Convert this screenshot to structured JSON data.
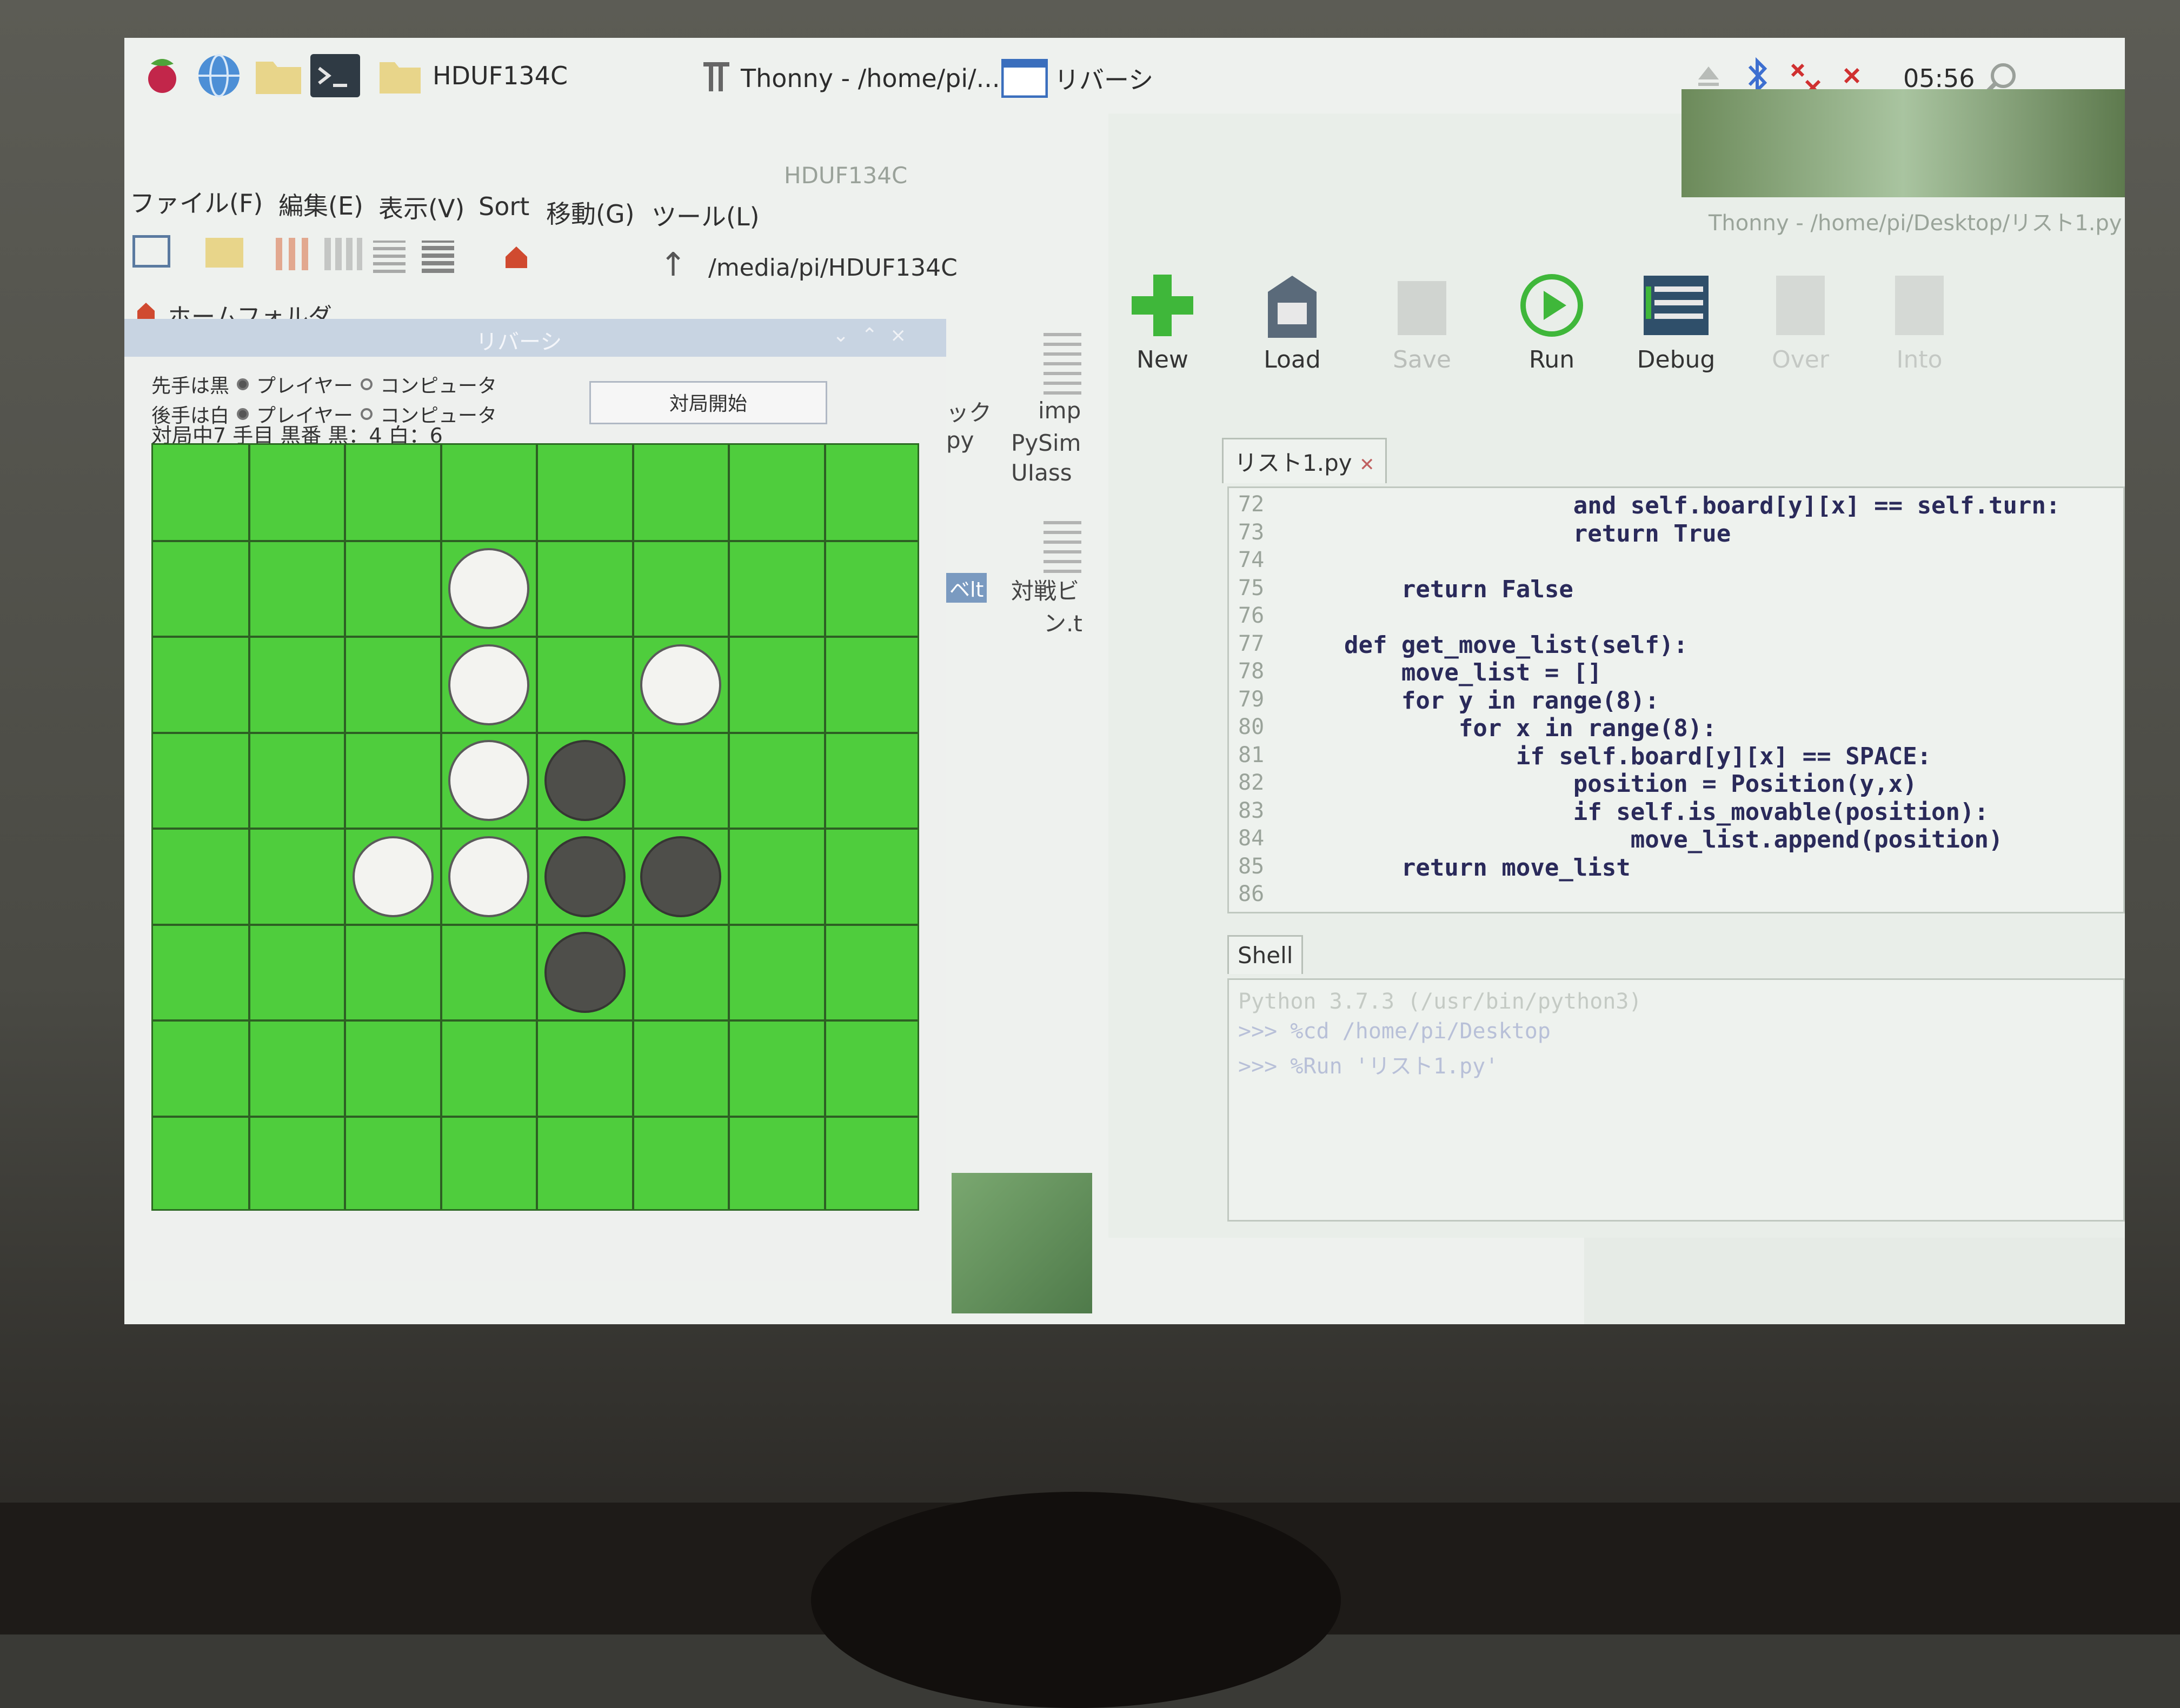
{
  "taskbar": {
    "folder_label": "HDUF134C",
    "thonny_label": "Thonny - /home/pi/...",
    "reversi_label": "リバーシ",
    "clock": "05:56"
  },
  "file_manager": {
    "title": "HDUF134C",
    "menu": [
      "ファイル(F)",
      "編集(E)",
      "表示(V)",
      "Sort",
      "移動(G)",
      "ツール(L)"
    ],
    "path": "/media/pi/HDUF134C",
    "home_folder": "ホームフォルダ",
    "files": [
      "ック",
      "py",
      "imp",
      "PySim",
      "UIass",
      "ベlt",
      "対戦ビ",
      "ン.t"
    ]
  },
  "reversi": {
    "title": "リバーシ",
    "first_label": "先手は黒",
    "second_label": "後手は白",
    "player_option": "プレイヤー",
    "computer_option": "コンピュータ",
    "start_button": "対局開始",
    "status": "対局中7 手目 黒番 黒：4 白：6",
    "board": [
      "........",
      "...W....",
      "...W.W..",
      "...WB...",
      "..WWBB..",
      "....B...",
      "........",
      "........"
    ]
  },
  "thonny": {
    "title": "Thonny - /home/pi/Desktop/リスト1.py",
    "toolbar": [
      "New",
      "Load",
      "Save",
      "Run",
      "Debug",
      "Over",
      "Into"
    ],
    "editor_tab": "リスト1.py",
    "line_numbers": [
      "72",
      "73",
      "74",
      "75",
      "76",
      "77",
      "78",
      "79",
      "80",
      "81",
      "82",
      "83",
      "84",
      "85",
      "86"
    ],
    "code": [
      "                    and self.board[y][x] == self.turn:",
      "                    return True",
      "",
      "        return False",
      "",
      "    def get_move_list(self):",
      "        move_list = []",
      "        for y in range(8):",
      "            for x in range(8):",
      "                if self.board[y][x] == SPACE:",
      "                    position = Position(y,x)",
      "                    if self.is_movable(position):",
      "                        move_list.append(position)",
      "        return move_list",
      ""
    ],
    "shell_tab": "Shell",
    "shell_lines": [
      "Python 3.7.3 (/usr/bin/python3)",
      ">>> %cd /home/pi/Desktop",
      ">>> %Run 'リスト1.py'"
    ]
  }
}
